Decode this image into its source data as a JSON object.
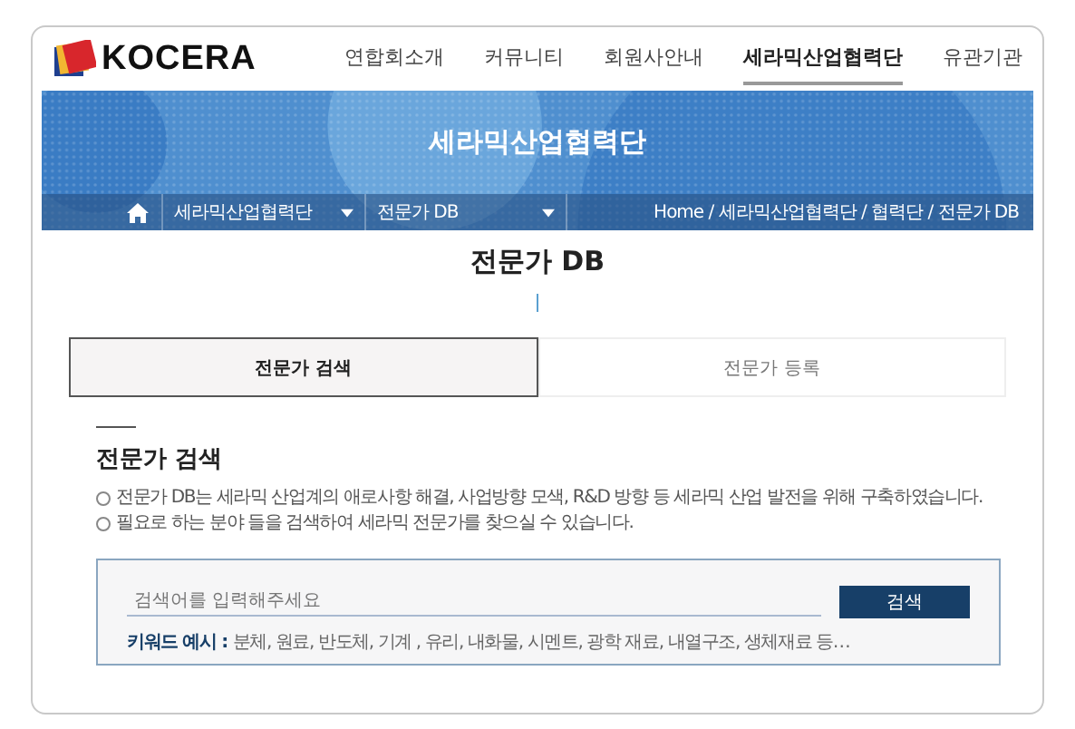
{
  "logo": {
    "text": "KOCERA"
  },
  "nav": [
    {
      "label": "연합회소개",
      "selected": false
    },
    {
      "label": "커뮤니티",
      "selected": false
    },
    {
      "label": "회원사안내",
      "selected": false
    },
    {
      "label": "세라믹산업협력단",
      "selected": true
    },
    {
      "label": "유관기관",
      "selected": false
    }
  ],
  "banner": {
    "title": "세라믹산업협력단"
  },
  "location_bar": {
    "dropdowns": [
      "세라믹산업협력단",
      "전문가 DB"
    ],
    "breadcrumb": "Home / 세라믹산업협력단 / 협력단 / 전문가 DB"
  },
  "page_title": "전문가 DB",
  "tabs": [
    {
      "label": "전문가 검색",
      "selected": true
    },
    {
      "label": "전문가 등록",
      "selected": false
    }
  ],
  "section": {
    "heading": "전문가 검색",
    "notes": [
      "전문가 DB는 세라믹 산업계의 애로사항 해결, 사업방향 모색, R&D 방향 등 세라믹 산업 발전을 위해 구축하였습니다.",
      "필요로 하는 분야 들을 검색하여 세라믹 전문가를 찾으실 수 있습니다."
    ]
  },
  "search": {
    "placeholder": "검색어를 입력해주세요",
    "button": "검색",
    "keywords_label": "키워드 예시 :",
    "keywords": "분체, 원료, 반도체, 기계 , 유리, 내화물, 시멘트, 광학 재료, 내열구조, 생체재료 등…"
  }
}
